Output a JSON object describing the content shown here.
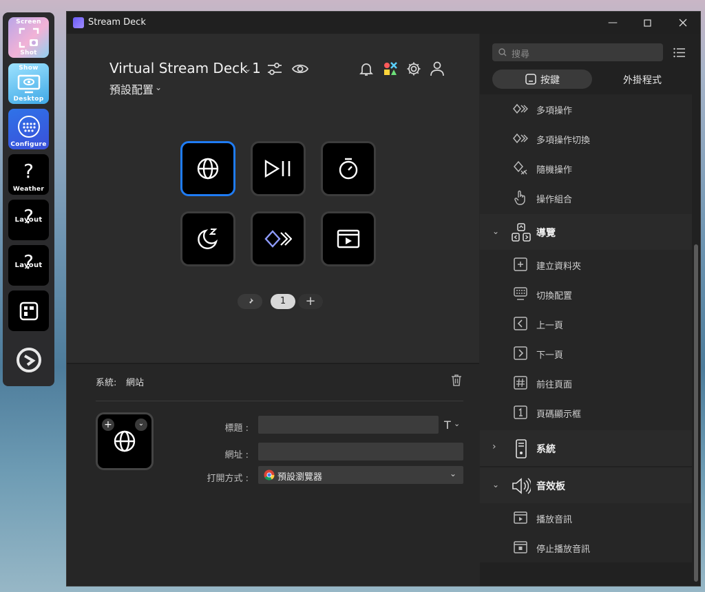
{
  "dock": {
    "items": [
      {
        "top": "Screen",
        "bottom": "Shot"
      },
      {
        "top": "Show",
        "bottom": "Desktop"
      },
      {
        "bottom": "Configure"
      },
      {
        "glyph": "?",
        "bottom": "Weather"
      },
      {
        "glyph": "?",
        "mid": "Layout"
      },
      {
        "glyph": "?",
        "mid": "Layout"
      }
    ]
  },
  "window": {
    "title": "Stream Deck"
  },
  "header": {
    "device": "Virtual Stream Deck 1",
    "profile": "預設配置"
  },
  "pager": {
    "page": "1"
  },
  "inspector": {
    "category": "系統:",
    "action": "網站",
    "title_label": "標題 :",
    "url_label": "網址 :",
    "open_label": "打開方式 :",
    "title_value": "",
    "url_value": "",
    "open_value": "預設瀏覽器",
    "title_font_glyph": "T"
  },
  "sidebar": {
    "search_placeholder": "搜尋",
    "tab_keys": "按鍵",
    "tab_plugins": "外掛程式",
    "multi": [
      "多項操作",
      "多項操作切換",
      "隨機操作",
      "操作組合"
    ],
    "nav_title": "導覽",
    "nav_items": [
      "建立資料夾",
      "切換配置",
      "上一頁",
      "下一頁",
      "前往頁面",
      "頁碼顯示框"
    ],
    "system_title": "系統",
    "sound_title": "音效板",
    "sound_items": [
      "播放音訊",
      "停止播放音訊"
    ]
  },
  "colors": {
    "accent": "#1f7cf4",
    "panel": "#2c2c2c",
    "sidebar": "#212121"
  }
}
